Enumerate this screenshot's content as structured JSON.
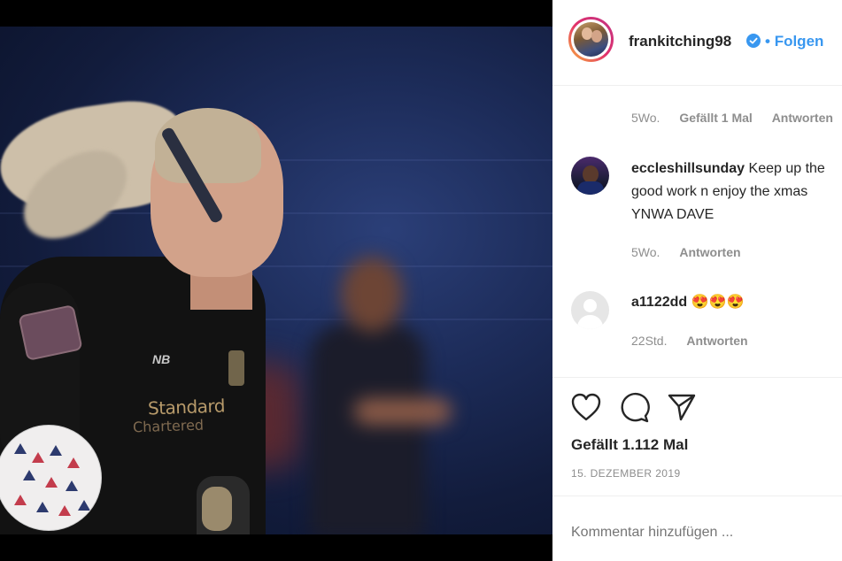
{
  "post": {
    "username": "frankitching98",
    "follow_separator": "•",
    "follow_label": "Folgen",
    "verified": true,
    "accent_color": "#3897f0"
  },
  "comments": [
    {
      "meta": {
        "age": "5Wo.",
        "likes": "Gefällt 1 Mal",
        "reply": "Antworten"
      }
    },
    {
      "username": "eccleshillsunday",
      "text_line1": "Keep up the",
      "text_line2": "good work n enjoy the xmas",
      "text_line3": "YNWA DAVE",
      "meta": {
        "age": "5Wo.",
        "reply": "Antworten"
      }
    },
    {
      "username": "a1122dd",
      "text": "😍😍😍",
      "meta": {
        "age": "22Std.",
        "reply": "Antworten"
      }
    }
  ],
  "actions": {
    "like_icon": "heart-icon",
    "comment_icon": "comment-icon",
    "share_icon": "share-icon"
  },
  "likes_text": "Gefällt 1.112 Mal",
  "date_text": "15. DEZEMBER 2019",
  "comment_placeholder": "Kommentar hinzufügen ...",
  "photo": {
    "shirt_text1": "Standard",
    "shirt_text2": "Chartered",
    "shirt_brand": "NB"
  }
}
